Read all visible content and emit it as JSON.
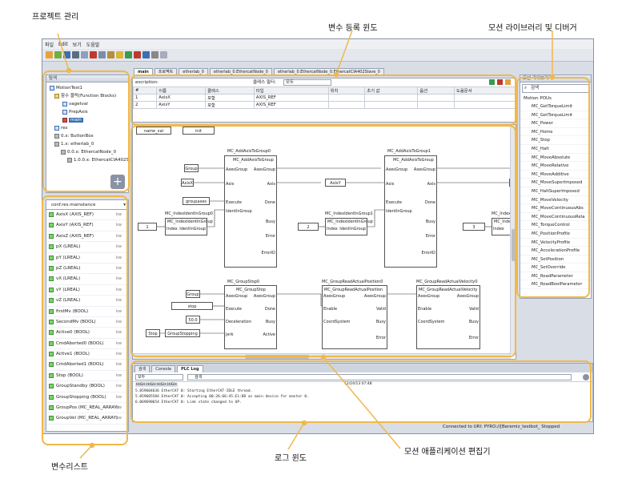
{
  "annotations": {
    "project": "프로젝트 관리",
    "var_register": "변수 등록 윈도",
    "motion_lib": "모션 라이브러리 및 디버거",
    "var_list": "변수리스트",
    "log": "로그 윈도",
    "editor": "모션 애플리케이션 편집기"
  },
  "menu": [
    "파일",
    "Edit",
    "보기",
    "도움말"
  ],
  "project": {
    "header": "탐색",
    "items": [
      "MotionTest1",
      "함수 블럭(Function Blocks)",
      "vagetval",
      "PrepAxis",
      "main",
      "res",
      "0.x: ButtonBox",
      "1.x: etherlab_0",
      "0.0.x: EthercatNode_0",
      "1.0.0.x: EthercatCIA402Slave_0"
    ]
  },
  "varpanel": {
    "resource": "conf.res.mainstance",
    "vars": [
      "AxisX (AXIS_REF)",
      "AxisY (AXIS_REF)",
      "AxisZ (AXIS_REF)",
      "pX (LREAL)",
      "pY (LREAL)",
      "pZ (LREAL)",
      "vX (LREAL)",
      "vY (LREAL)",
      "vZ (LREAL)",
      "firstMv (BOOL)",
      "SecondMv (BOOL)",
      "Active0 (BOOL)",
      "CmdAborted0 (BOOL)",
      "Active1 (BOOL)",
      "CmdAborted1 (BOOL)",
      "Stop (BOOL)",
      "GroupStandby (BOOL)",
      "GroupStopping (BOOL)",
      "GroupPos (MC_REAL_ARRAY)",
      "GroupVel (MC_REAL_ARRAY)"
    ],
    "kw": "kw"
  },
  "tabs": [
    "main",
    "프로젝트",
    "etherlab_0",
    "etherlab_0.EthercatNode_0",
    "etherlab_0.EthercatNode_0.EthercatCIA402Slave_0"
  ],
  "vargrid": {
    "desc": "escription:",
    "filter": "클래스 필터:",
    "filter_val": "모두",
    "headers": [
      "#",
      "이름",
      "클래스",
      "타입",
      "위치",
      "초기 값",
      "옵션",
      "도움문서"
    ],
    "rows": [
      [
        "1",
        "AxisX",
        "포함",
        "AXIS_REF"
      ],
      [
        "2",
        "AxisY",
        "포함",
        "AXIS_REF"
      ]
    ]
  },
  "fbd": {
    "add0": {
      "title": "MC_AddAxisToGroup0",
      "name": "MC_AddAxisToGroup",
      "in": [
        "AxesGroup",
        "Axis",
        "Execute",
        "IdentInGroup"
      ],
      "out": [
        "AxesGroup",
        "Axis",
        "Done",
        "Busy",
        "Error",
        "ErrorID"
      ]
    },
    "add1": {
      "title": "MC_AddAxisToGroup1",
      "name": "MC_AddAxisToGroup",
      "in": [
        "AxesGroup",
        "Axis",
        "Execute",
        "IdentInGroup"
      ],
      "out": [
        "AxesGroup",
        "Axis",
        "Done",
        "Busy",
        "Error",
        "ErrorID"
      ]
    },
    "idx0": {
      "title": "MC_IndexIdentInGroup0",
      "name": "MC_IndexIdentInGroup",
      "in": "Index",
      "out": "IdentInGroup"
    },
    "idx1": {
      "title": "MC_IndexIdentInGroup1",
      "name": "MC_IndexIdentInGroup",
      "in": "Index",
      "out": "IdentInGroup"
    },
    "idx2": {
      "title": "MC_IndexI",
      "name": "MC_Index",
      "in": "Index"
    },
    "stop0": {
      "title": "MC_GroupStop0",
      "name": "MC_GroupStop",
      "in": [
        "AxesGroup",
        "Execute",
        "Deceleration",
        "Jerk"
      ],
      "out": [
        "AxesGroup",
        "Done",
        "Busy",
        "Active"
      ]
    },
    "pos0": {
      "title": "MC_GroupReadActualPosition0",
      "name": "MC_GroupReadActualPosition",
      "in": [
        "AxesGroup",
        "Enable",
        "CoordSystem"
      ],
      "out": [
        "AxesGroup",
        "Valid",
        "Busy",
        "Error"
      ]
    },
    "vel0": {
      "title": "MC_GroupReadActualVelocity0",
      "name": "MC_GroupReadActualVelocity",
      "in": [
        "AxesGroup",
        "Enable",
        "CoordSystem"
      ],
      "out": [
        "AxesGroup",
        "Valid",
        "Busy",
        "Error"
      ]
    },
    "labels": {
      "name_val": "name_val",
      "init": "init",
      "group": "Group",
      "axisx": "AxisX",
      "axisy": "AxisY",
      "groupaxes": "groupaxes",
      "one": "1",
      "two": "2",
      "three": "3",
      "a": "A",
      "stop": "stop",
      "decel": "50.0",
      "stopvar": "Stop",
      "gstopping": "GroupStopping"
    }
  },
  "motion": {
    "header": "모션 라이브러리",
    "search": "검색",
    "root": "Motion POUs",
    "items": [
      "MC_GetTorqueLimit",
      "MC_GetTorqueLimit",
      "MC_Power",
      "MC_Home",
      "MC_Stop",
      "MC_Halt",
      "MC_MoveAbsolute",
      "MC_MoveRelative",
      "MC_MoveAdditive",
      "MC_MoveSuperImposed",
      "MC_HaltSuperImposed",
      "MC_MoveVelocity",
      "MC_MoveContinuousAbs",
      "MC_MoveContinuousRela",
      "MC_TorqueControl",
      "MC_PositionProfile",
      "MC_VelocityProfile",
      "MC_AccelerationProfile",
      "MC_SetPosition",
      "MC_SetOverride",
      "MC_ReadParameter",
      "MC_ReadBoolParameter"
    ]
  },
  "log": {
    "tabs": [
      "검색",
      "Console",
      "PLC Log"
    ],
    "filter": "모두",
    "search": "검색",
    "timestamp": "12/24/13 07:48",
    "lines": [
      "5.059604636 EtherCAT 0: Starting EtherCAT-IDLE thread.",
      "5.059605584 EtherCAT 0: Accepting 00:26:66:45:E1:DD as main device for master 0.",
      "6.069690654 EtherCAT 0: Link state changed to UP."
    ],
    "chips": [
      "HIGH",
      "HIGH",
      "HIGH",
      "HIGH"
    ]
  },
  "status": "Connected to URI: PYRO://[Beremiz_testbot_ Stopped",
  "colors": {
    "highlight": "#f0b84a",
    "accent": "#3a6fb5"
  }
}
